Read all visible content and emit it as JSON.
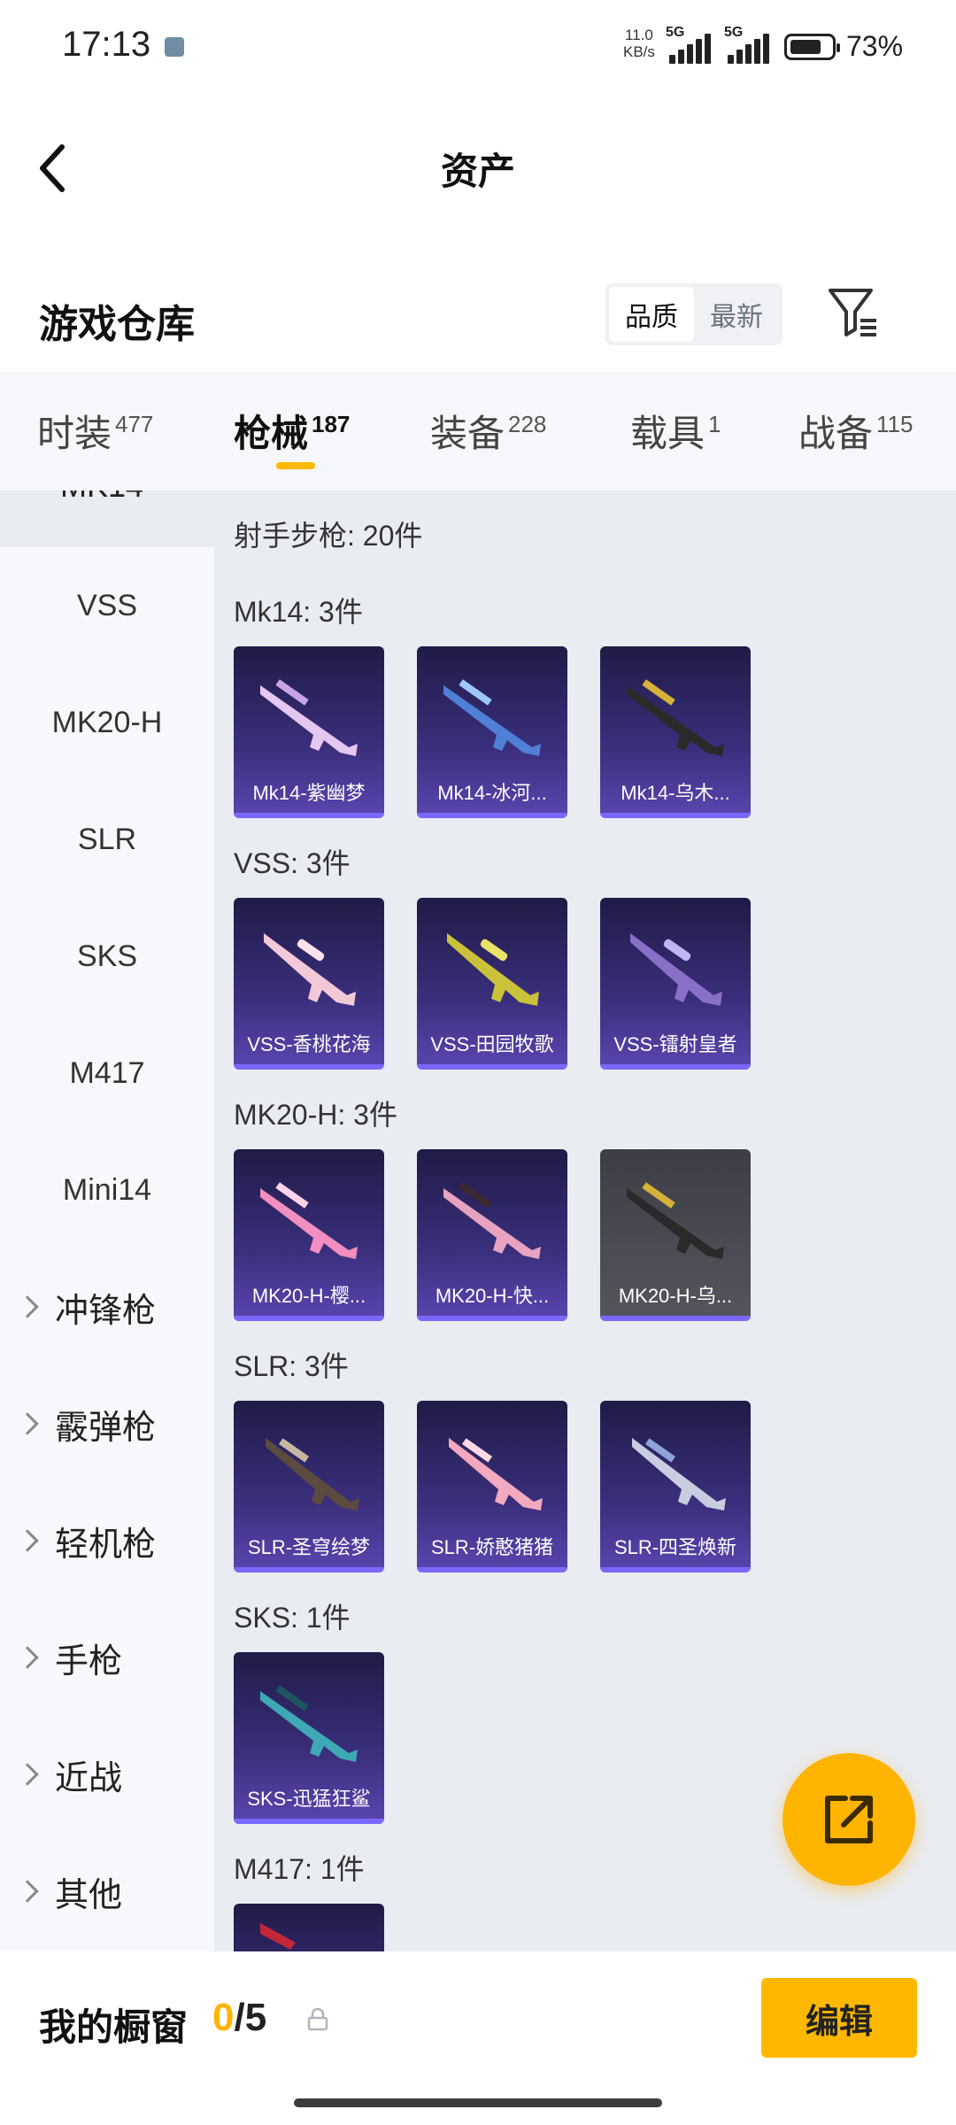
{
  "status_bar": {
    "time": "17:13",
    "net_speed_value": "11.0",
    "net_speed_unit": "KB/s",
    "signal1": "5G",
    "signal2": "5G",
    "battery_pct": "73%",
    "battery_level": 0.73
  },
  "header": {
    "title": "资产"
  },
  "subheader": {
    "title": "游戏仓库",
    "sort_quality": "品质",
    "sort_newest": "最新",
    "active_sort": "品质"
  },
  "tabs": [
    {
      "label": "时装",
      "count": "477"
    },
    {
      "label": "枪械",
      "count": "187"
    },
    {
      "label": "装备",
      "count": "228"
    },
    {
      "label": "载具",
      "count": "1"
    },
    {
      "label": "战备",
      "count": "115"
    }
  ],
  "active_tab": "枪械",
  "sidebar": {
    "partial_top": "MK14",
    "items": [
      "VSS",
      "MK20-H",
      "SLR",
      "SKS",
      "M417",
      "Mini14"
    ],
    "groups": [
      "冲锋枪",
      "霰弹枪",
      "轻机枪",
      "手枪",
      "近战",
      "其他"
    ]
  },
  "content": {
    "total": "射手步枪: 20件",
    "sections": [
      {
        "title": "Mk14: 3件",
        "items": [
          "Mk14-紫幽梦",
          "Mk14-冰河...",
          "Mk14-乌木..."
        ]
      },
      {
        "title": "VSS: 3件",
        "items": [
          "VSS-香桃花海",
          "VSS-田园牧歌",
          "VSS-镭射皇者"
        ]
      },
      {
        "title": "MK20-H: 3件",
        "items": [
          "MK20-H-樱...",
          "MK20-H-快...",
          "MK20-H-乌..."
        ]
      },
      {
        "title": "SLR: 3件",
        "items": [
          "SLR-圣穹绘梦",
          "SLR-娇憨猪猪",
          "SLR-四圣焕新"
        ]
      },
      {
        "title": "SKS: 1件",
        "items": [
          "SKS-迅猛狂鲨"
        ]
      },
      {
        "title": "M417: 1件",
        "items": [
          ""
        ]
      }
    ]
  },
  "bottom_bar": {
    "title": "我的橱窗",
    "current": "0",
    "separator": "/",
    "max": "5",
    "edit_label": "编辑"
  },
  "colors": {
    "accent": "#FFB800",
    "card_bg": "#3B2F7D",
    "card_bar": "#7A68FF"
  }
}
